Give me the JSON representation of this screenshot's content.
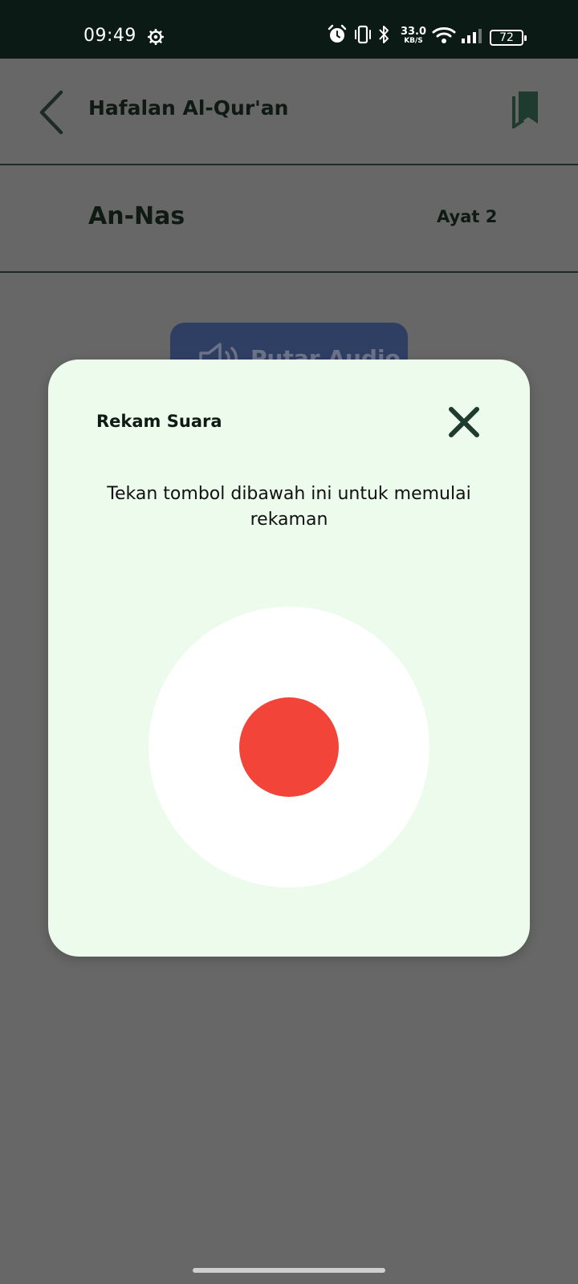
{
  "status_bar": {
    "time": "09:49",
    "network_speed": "33.0",
    "network_speed_unit": "KB/S",
    "battery": "72",
    "icons": [
      "settings-icon",
      "alarm-icon",
      "vibrate-icon",
      "bluetooth-icon",
      "wifi-icon",
      "signal-icon",
      "battery-icon"
    ]
  },
  "app_bar": {
    "title": "Hafalan Al-Qur'an",
    "icons": [
      "back-arrow-icon",
      "bookmark-icon"
    ]
  },
  "surah": {
    "name": "An-Nas",
    "ayat": "Ayat 2"
  },
  "audio_button": {
    "label": "Putar Audio",
    "icon": "speaker-icon"
  },
  "dialog": {
    "title": "Rekam Suara",
    "instruction": "Tekan tombol dibawah ini untuk memulai rekaman",
    "close_icon": "close-icon"
  },
  "colors": {
    "status_bar_bg": "#0c1a15",
    "scrim": "#676767",
    "dialog_bg": "#ecfbec",
    "record_red": "#f3443a",
    "audio_button_bg": "#2f3f63",
    "dark_green": "#1f3a2e"
  }
}
